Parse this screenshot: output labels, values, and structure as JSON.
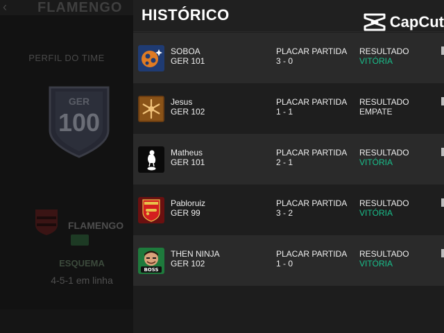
{
  "background": {
    "title": "FLAMENGO",
    "profile_label": "PERFIL DO TIME",
    "shield": {
      "ger_label": "GER",
      "ovr": "100"
    },
    "team_name": "FLAMENGO",
    "formation_label": "ESQUEMA",
    "formation": "4-5-1 em linha"
  },
  "panel": {
    "title": "HISTÓRICO"
  },
  "watermark": {
    "text": "CapCut"
  },
  "history": [
    {
      "name": "SOBOA",
      "ger": "GER 101",
      "score_label": "PLACAR PARTIDA",
      "score": "3 - 0",
      "result_label": "RESULTADO",
      "result": "VITÓRIA",
      "avatar": "orange-blue-emblem"
    },
    {
      "name": "Jesus",
      "ger": "GER 102",
      "score_label": "PLACAR PARTIDA",
      "score": "1 - 1",
      "result_label": "RESULTADO",
      "result": "EMPATE",
      "avatar": "snowflake-emblem"
    },
    {
      "name": "Matheus",
      "ger": "GER 101",
      "score_label": "PLACAR PARTIDA",
      "score": "2 - 1",
      "result_label": "RESULTADO",
      "result": "VITÓRIA",
      "avatar": "rooster-crest"
    },
    {
      "name": "Pabloruiz",
      "ger": "GER 99",
      "score_label": "PLACAR PARTIDA",
      "score": "3 - 2",
      "result_label": "RESULTADO",
      "result": "VITÓRIA",
      "avatar": "cannon-crest"
    },
    {
      "name": "THEN NINJA",
      "ger": "GER 102",
      "score_label": "PLACAR PARTIDA",
      "score": "1 - 0",
      "result_label": "RESULTADO",
      "result": "VITÓRIA",
      "avatar": "boss-character"
    }
  ],
  "colors": {
    "win": "#19c08c",
    "draw": "#e8e8e8",
    "panel": "#1d1d1d",
    "row_alt": "#2a2a2a"
  }
}
